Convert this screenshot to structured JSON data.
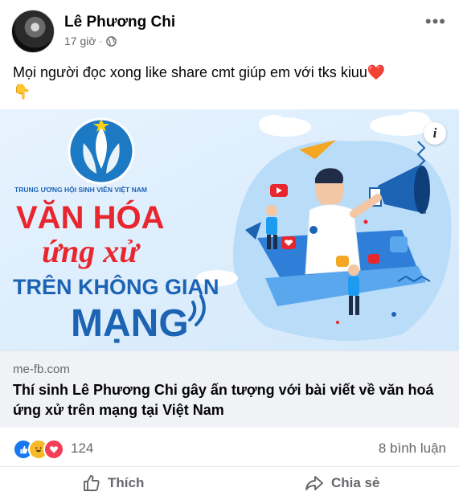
{
  "post": {
    "author": "Lê Phương Chi",
    "time": "17 giờ",
    "separator": "·",
    "text": "Mọi người đọc xong like share cmt giúp em với tks kiuu",
    "emoji_heart": "❤️",
    "emoji_point": "👇"
  },
  "link": {
    "domain": "me-fb.com",
    "title": "Thí sinh Lê Phương Chi gây ấn tượng với bài viết về văn hoá ứng xử trên mạng tại Việt Nam",
    "info_glyph": "i",
    "image": {
      "org_name": "TRUNG ƯƠNG HỘI SINH VIÊN VIỆT NAM",
      "logo_text": "HỘI SINH VIÊN VIỆT NAM",
      "line1": "VĂN HÓA",
      "line2": "ứng xử",
      "line3": "TRÊN KHÔNG GIAN",
      "line4": "MẠNG"
    }
  },
  "reactions": {
    "count": "124",
    "comments": "8 bình luận",
    "types": [
      "like-icon",
      "haha-icon",
      "love-icon"
    ]
  },
  "actions": {
    "like_label": "Thích",
    "share_label": "Chia sẻ"
  },
  "colors": {
    "brand_blue": "#1877f2",
    "text_secondary": "#65676b",
    "headline_red": "#e8262d",
    "headline_blue": "#1d63b4"
  }
}
